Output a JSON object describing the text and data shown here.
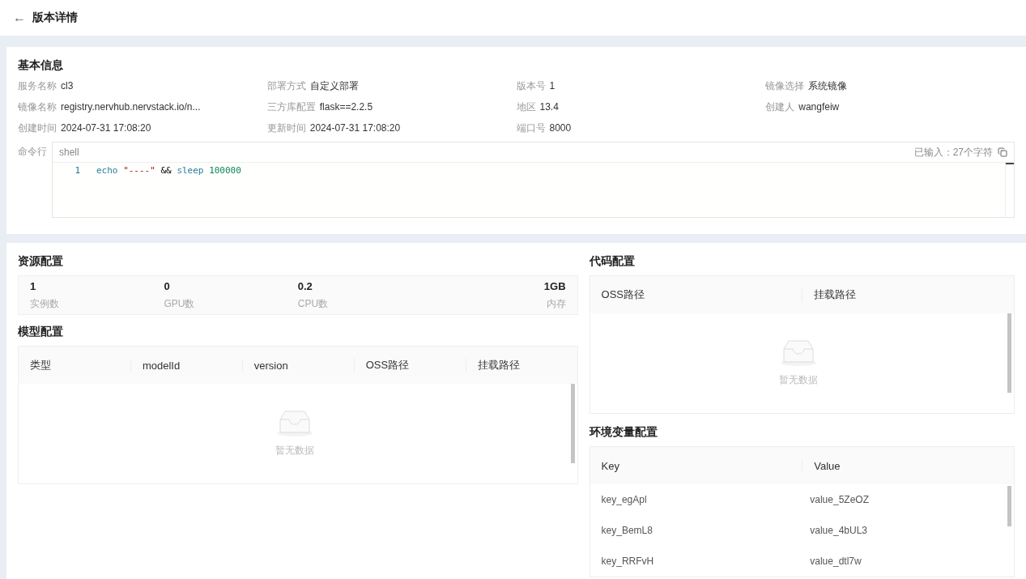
{
  "header": {
    "back": "←",
    "title": "版本详情"
  },
  "basic": {
    "title": "基本信息",
    "fields": [
      {
        "label": "服务名称",
        "value": "cl3"
      },
      {
        "label": "部署方式",
        "value": "自定义部署"
      },
      {
        "label": "版本号",
        "value": "1"
      },
      {
        "label": "镜像选择",
        "value": "系统镜像"
      },
      {
        "label": "镜像名称",
        "value": "registry.nervhub.nervstack.io/n..."
      },
      {
        "label": "三方库配置",
        "value": "flask==2.2.5"
      },
      {
        "label": "地区",
        "value": "13.4"
      },
      {
        "label": "创建人",
        "value": "wangfeiw"
      },
      {
        "label": "创建时间",
        "value": "2024-07-31 17:08:20"
      },
      {
        "label": "更新时间",
        "value": "2024-07-31 17:08:20"
      },
      {
        "label": "端口号",
        "value": "8000"
      }
    ],
    "command": {
      "label": "命令行",
      "language": "shell",
      "counter": "已输入：27个字符",
      "lines": [
        {
          "number": "1",
          "tokens": [
            {
              "kind": "keyword",
              "text": "echo"
            },
            {
              "kind": "string",
              "text": "\"----\""
            },
            {
              "kind": "plain",
              "text": "&&"
            },
            {
              "kind": "keyword",
              "text": "sleep"
            },
            {
              "kind": "number",
              "text": "100000"
            }
          ]
        }
      ]
    }
  },
  "resources": {
    "title": "资源配置",
    "items": [
      {
        "value": "1",
        "label": "实例数"
      },
      {
        "value": "0",
        "label": "GPU数"
      },
      {
        "value": "0.2",
        "label": "CPU数"
      },
      {
        "value": "1GB",
        "label": "内存"
      }
    ]
  },
  "model": {
    "title": "模型配置",
    "columns": [
      "类型",
      "modelId",
      "version",
      "OSS路径",
      "挂载路径"
    ],
    "empty": "暂无数据"
  },
  "code": {
    "title": "代码配置",
    "columns": [
      "OSS路径",
      "挂载路径"
    ],
    "empty": "暂无数据"
  },
  "env": {
    "title": "环境变量配置",
    "columns": [
      "Key",
      "Value"
    ],
    "rows": [
      [
        "key_egApl",
        "value_5ZeOZ"
      ],
      [
        "key_BemL8",
        "value_4bUL3"
      ],
      [
        "key_RRFvH",
        "value_dtl7w"
      ]
    ]
  }
}
